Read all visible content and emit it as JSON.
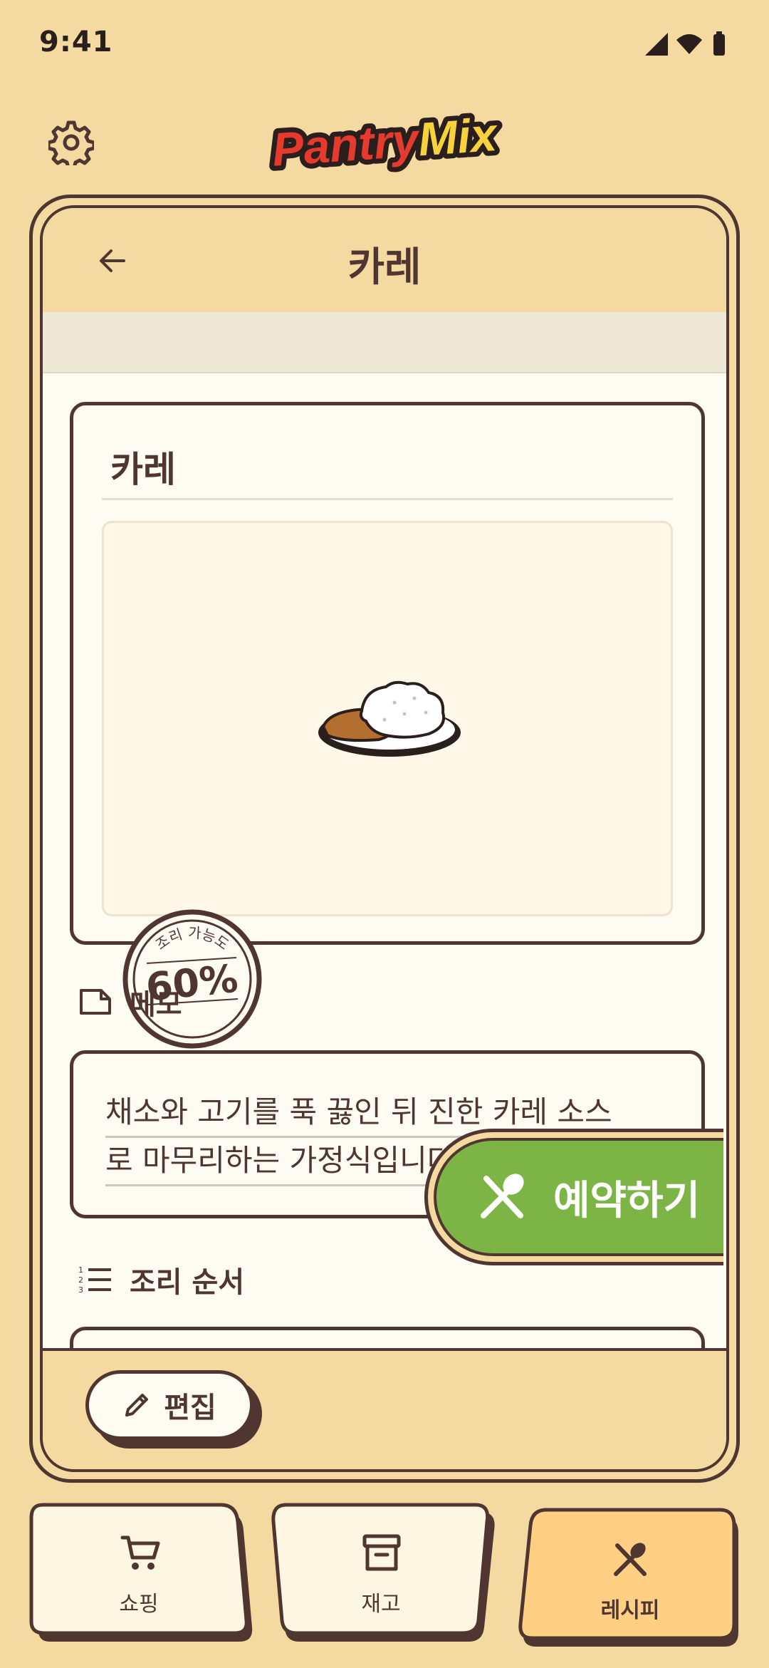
{
  "status_bar": {
    "time": "9:41"
  },
  "header": {
    "logo_text": "PantryMix"
  },
  "recipe_header": {
    "title": "카레"
  },
  "recipe": {
    "name": "카레",
    "progress_label": "조리 가능도",
    "progress_value": "60%",
    "progress_fraction": 0.6
  },
  "memo": {
    "label": "메모",
    "lines": [
      "채소와 고기를 푹 끓인 뒤 진한 카레 소스",
      "로 마무리하는 가정식입니다."
    ]
  },
  "steps": {
    "label": "조리 순서"
  },
  "actions": {
    "edit_label": "편집",
    "reserve_label": "예약하기"
  },
  "tabs": [
    {
      "label": "쇼핑",
      "icon": "cart-icon",
      "active": false
    },
    {
      "label": "재고",
      "icon": "archive-box-icon",
      "active": false
    },
    {
      "label": "레시피",
      "icon": "utensils-icon",
      "active": true
    }
  ],
  "colors": {
    "background": "#f4d9a1",
    "ink": "#4f3630",
    "card": "#fdfbf2",
    "accent_green": "#7cb445",
    "active_tab": "#ffcf84",
    "logo_red": "#e53a2e",
    "logo_yellow": "#f7d23c"
  }
}
